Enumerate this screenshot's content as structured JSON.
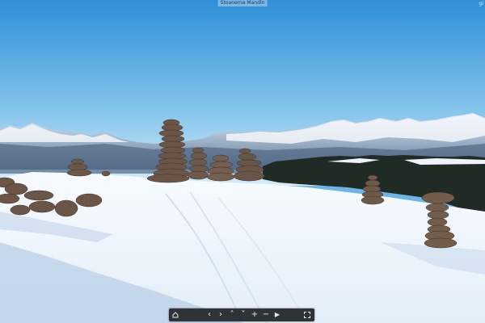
{
  "viewer": {
    "title": "Stoanerne Mandln",
    "corner_label": "gi"
  },
  "toolbar": {
    "buttons": [
      {
        "name": "home-button",
        "icon": "home-icon",
        "glyph": ""
      },
      {
        "name": "pan-left-button",
        "icon": "chevron-left-icon",
        "glyph": "‹"
      },
      {
        "name": "pan-right-button",
        "icon": "chevron-right-icon",
        "glyph": "›"
      },
      {
        "name": "pan-up-button",
        "icon": "chevron-up-icon",
        "glyph": "˄"
      },
      {
        "name": "pan-down-button",
        "icon": "chevron-down-icon",
        "glyph": "˅"
      },
      {
        "name": "zoom-in-button",
        "icon": "plus-icon",
        "glyph": "+"
      },
      {
        "name": "zoom-out-button",
        "icon": "minus-icon",
        "glyph": "−"
      },
      {
        "name": "autoplay-button",
        "icon": "play-icon",
        "glyph": "▶"
      },
      {
        "name": "fullscreen-button",
        "icon": "fullscreen-icon",
        "glyph": ""
      }
    ]
  },
  "colors": {
    "sky_top": "#2f8fd8",
    "sky_bottom": "#cfe8f6",
    "snow": "#f4f8fc",
    "snow_shadow": "#a9c4df",
    "forest": "#1f2b24",
    "rock": "#6b5546",
    "toolbar_bg": "#2f3338"
  }
}
